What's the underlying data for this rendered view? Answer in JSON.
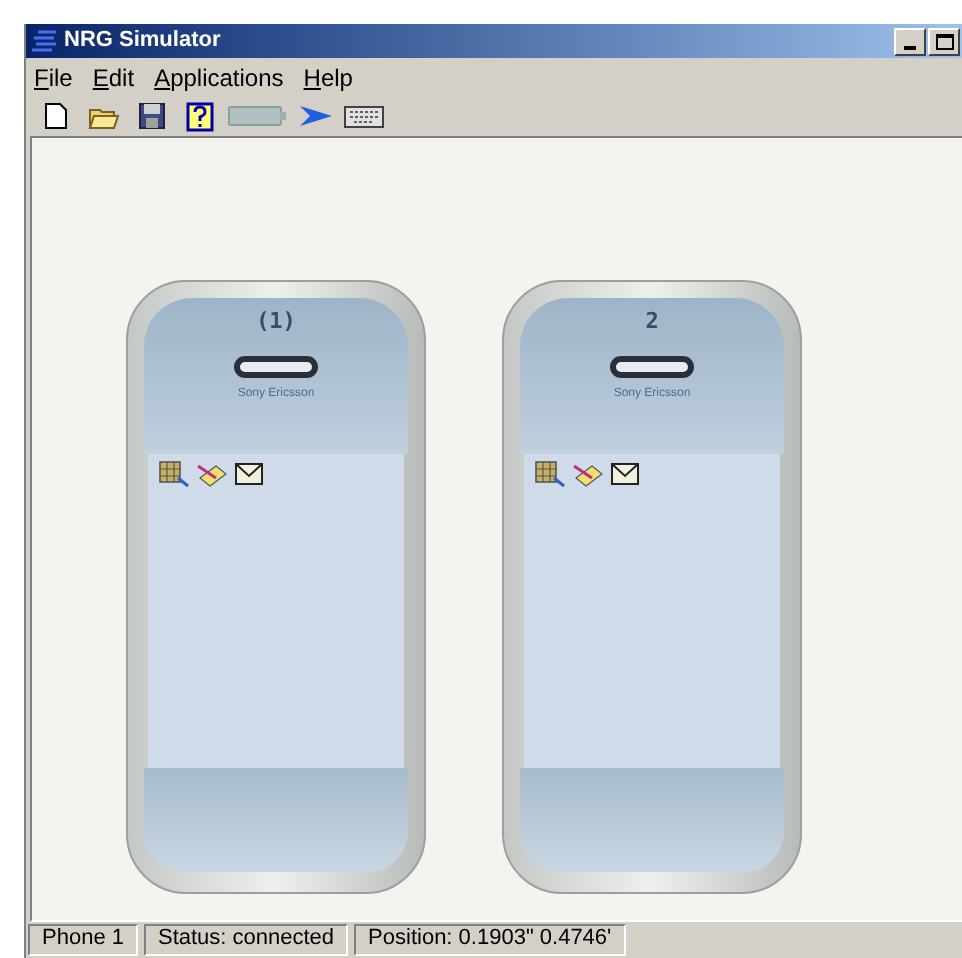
{
  "window": {
    "title": "NRG Simulator"
  },
  "menu": [
    "File",
    "Edit",
    "Applications",
    "Help"
  ],
  "phones": [
    {
      "label": "(1)",
      "brand": "Sony Ericsson"
    },
    {
      "label": "2",
      "brand": "Sony Ericsson"
    }
  ],
  "status_bar": [
    "Phone 1",
    "Status: connected",
    "Position: 0.1903\" 0.4746'"
  ]
}
